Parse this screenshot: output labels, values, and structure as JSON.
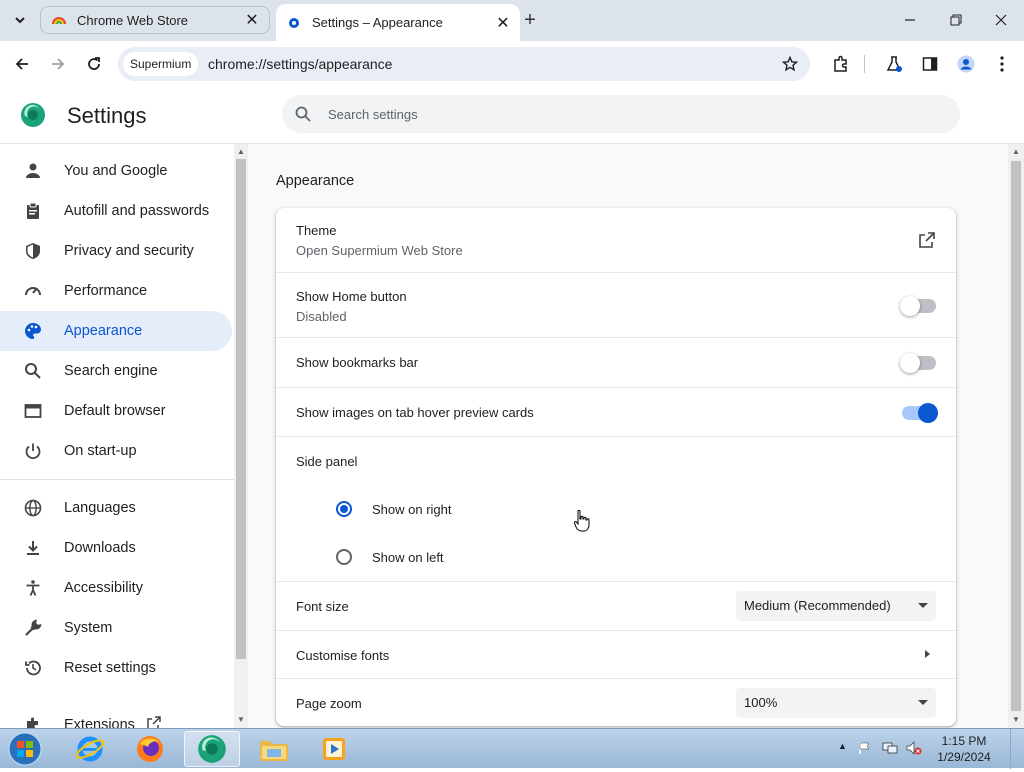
{
  "browser": {
    "tabs": [
      {
        "title": "Chrome Web Store",
        "icon": "rainbow-store-icon"
      },
      {
        "title": "Settings – Appearance",
        "icon": "gear-icon",
        "active": true
      }
    ],
    "address": {
      "site_chip": "Supermium",
      "url": "chrome://settings/appearance"
    }
  },
  "settings": {
    "title": "Settings",
    "search_placeholder": "Search settings"
  },
  "sidebar": {
    "items": [
      {
        "label": "You and Google",
        "icon": "person-icon"
      },
      {
        "label": "Autofill and passwords",
        "icon": "clipboard-icon"
      },
      {
        "label": "Privacy and security",
        "icon": "shield-icon"
      },
      {
        "label": "Performance",
        "icon": "gauge-icon"
      },
      {
        "label": "Appearance",
        "icon": "palette-icon",
        "selected": true
      },
      {
        "label": "Search engine",
        "icon": "search-icon"
      },
      {
        "label": "Default browser",
        "icon": "browser-window-icon"
      },
      {
        "label": "On start-up",
        "icon": "power-icon"
      },
      {
        "label": "Languages",
        "icon": "globe-icon"
      },
      {
        "label": "Downloads",
        "icon": "download-icon"
      },
      {
        "label": "Accessibility",
        "icon": "accessibility-icon"
      },
      {
        "label": "System",
        "icon": "wrench-icon"
      },
      {
        "label": "Reset settings",
        "icon": "history-icon"
      },
      {
        "label": "Extensions",
        "icon": "puzzle-icon"
      }
    ]
  },
  "appearance": {
    "section_title": "Appearance",
    "theme": {
      "label": "Theme",
      "sublabel": "Open Supermium Web Store"
    },
    "home_button": {
      "label": "Show Home button",
      "sublabel": "Disabled",
      "enabled": false
    },
    "bookmarks_bar": {
      "label": "Show bookmarks bar",
      "enabled": false
    },
    "tab_hover_images": {
      "label": "Show images on tab hover preview cards",
      "enabled": true
    },
    "side_panel": {
      "label": "Side panel",
      "options": [
        "Show on right",
        "Show on left"
      ],
      "selected": "Show on right"
    },
    "font_size": {
      "label": "Font size",
      "value": "Medium (Recommended)"
    },
    "customise_fonts": {
      "label": "Customise fonts"
    },
    "page_zoom": {
      "label": "Page zoom",
      "value": "100%"
    }
  },
  "taskbar": {
    "time": "1:15 PM",
    "date": "1/29/2024"
  },
  "colors": {
    "accent": "#0b57d0",
    "selected_nav_bg": "#e5ecfa",
    "tabstrip_bg": "#dde3ea"
  }
}
